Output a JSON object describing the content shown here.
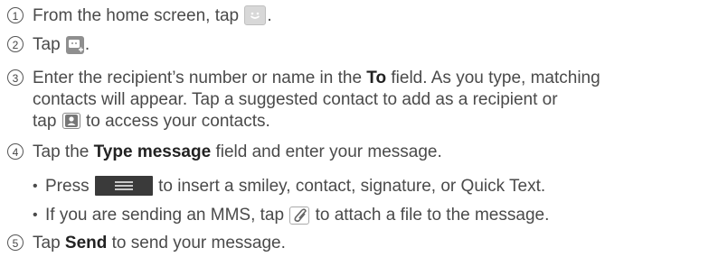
{
  "steps": [
    {
      "num": "1",
      "before": "From the home screen, tap ",
      "after": ".",
      "icon": "messages-app-icon"
    },
    {
      "num": "2",
      "before": "Tap ",
      "after": ".",
      "icon": "new-message-icon"
    },
    {
      "num": "3",
      "line1_before": "Enter the recipient’s number or name in the ",
      "line1_bold": "To",
      "line1_after": " field. As you type, matching",
      "line2": "contacts will appear. Tap a suggested contact to add as a recipient or",
      "line3_before": "tap ",
      "line3_after": " to access your contacts.",
      "icon": "contacts-icon"
    },
    {
      "num": "4",
      "before": "Tap the ",
      "bold": "Type message",
      "after": " field and enter your message."
    },
    {
      "num": "5",
      "before": "Tap ",
      "bold": "Send",
      "after": " to send your message."
    }
  ],
  "bullets": [
    {
      "before": "Press ",
      "after": " to insert a smiley, contact, signature, or Quick Text.",
      "icon": "menu-key-icon"
    },
    {
      "before": "If you are sending an MMS, tap ",
      "after": " to attach a file to the message.",
      "icon": "paperclip-icon"
    }
  ],
  "bullet_glyph": "•",
  "colors": {
    "text": "#4a4a4a",
    "bold": "#222222"
  }
}
